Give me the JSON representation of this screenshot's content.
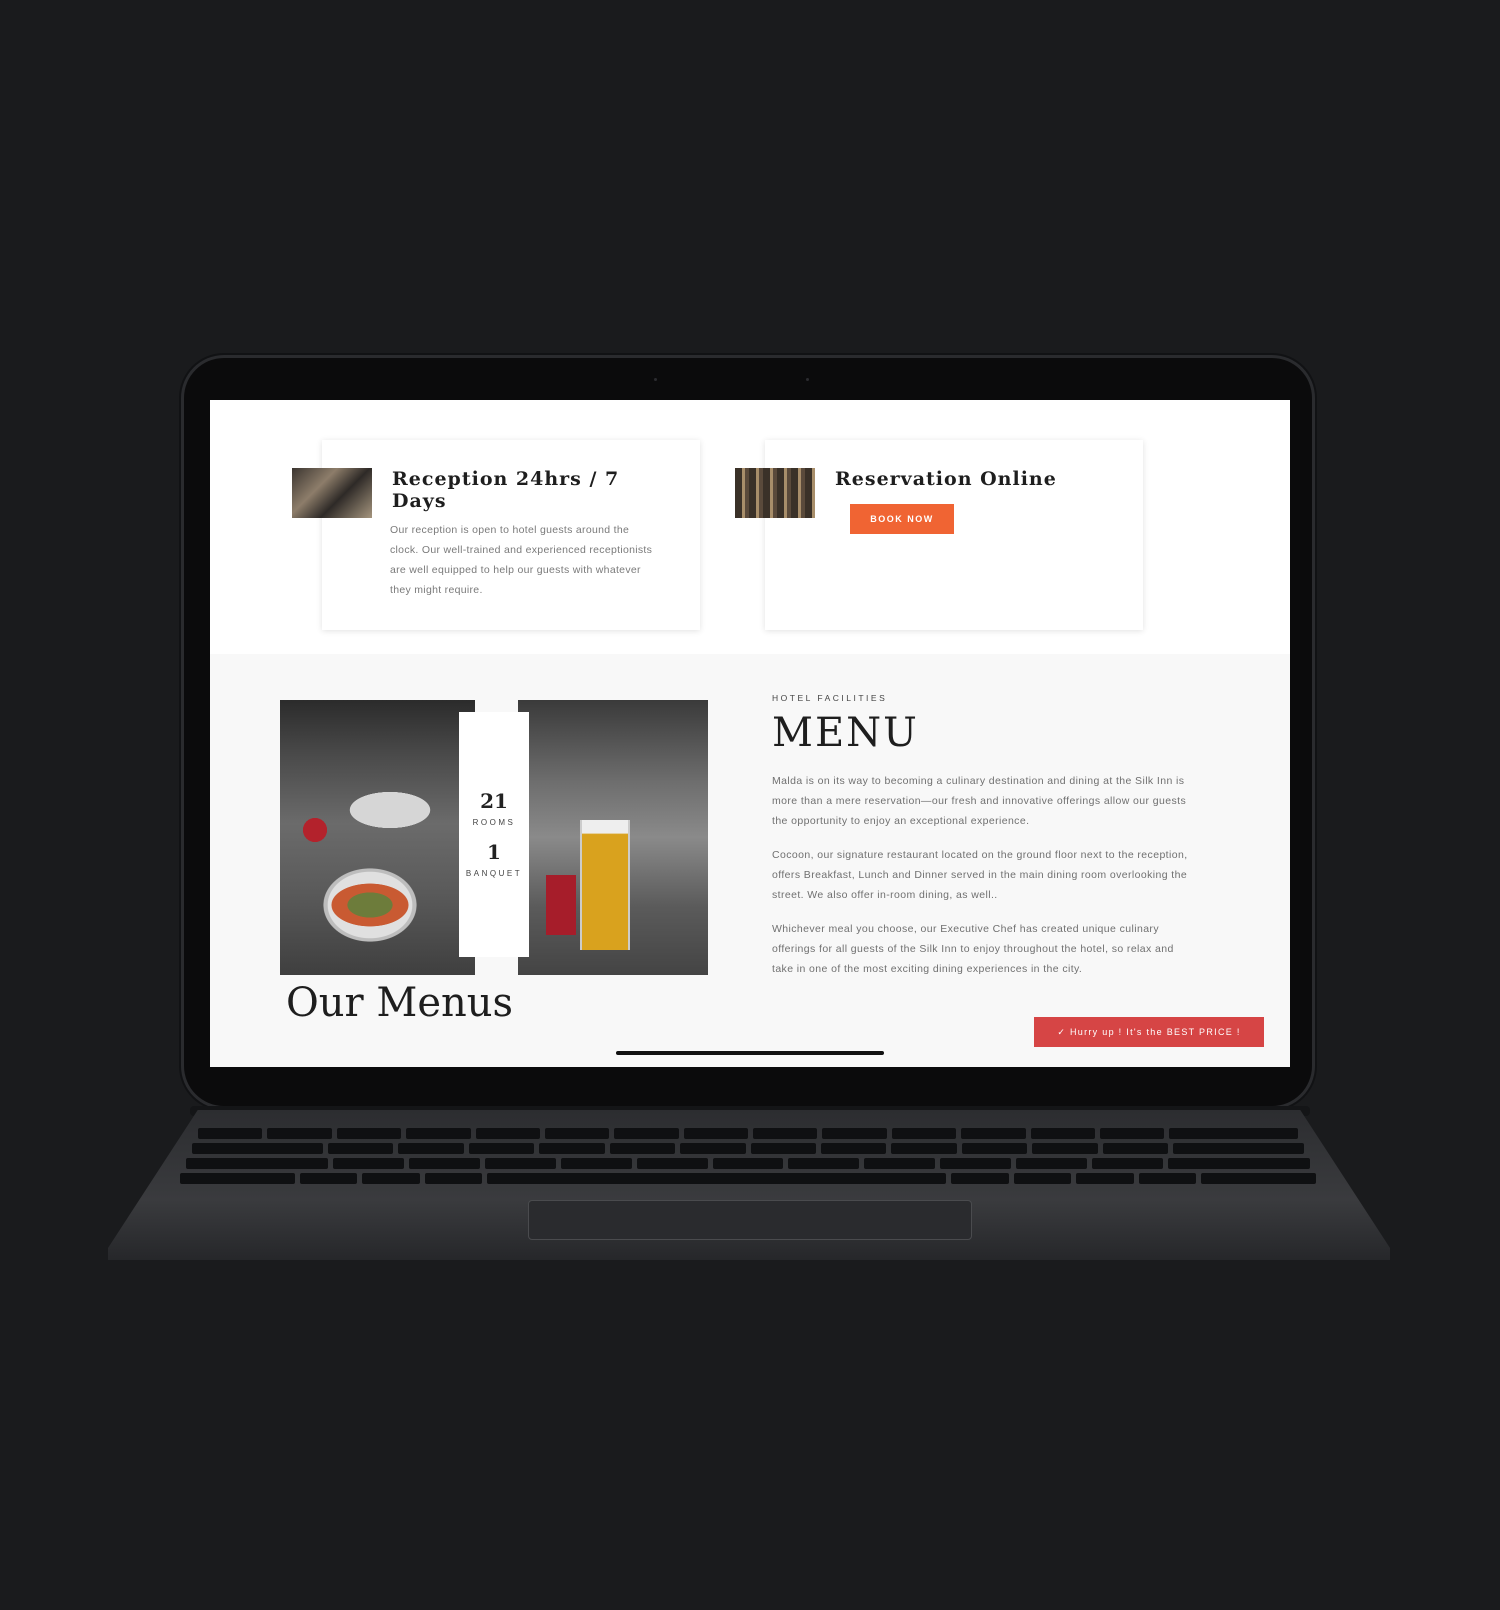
{
  "cards": {
    "reception": {
      "title": "Reception 24hrs / 7 Days",
      "text": "Our reception is open to hotel guests around the clock. Our well-trained and experienced receptionists are well equipped to help our guests with whatever they might require."
    },
    "reservation": {
      "title": "Reservation Online",
      "button_label": "BOOK NOW"
    }
  },
  "stats": [
    {
      "value": "21",
      "label": "ROOMS"
    },
    {
      "value": "1",
      "label": "BANQUET"
    }
  ],
  "facilities": {
    "eyebrow": "HOTEL FACILITIES",
    "heading": "MENU",
    "paragraphs": [
      "Malda is on its way to becoming a culinary destination and dining at the Silk Inn is more than a mere reservation—our fresh and innovative offerings allow our guests the opportunity to enjoy an exceptional experience.",
      "Cocoon, our signature restaurant located on the ground floor next to the reception, offers Breakfast, Lunch and Dinner served in the main dining room overlooking the street. We also offer in-room dining, as well..",
      "Whichever meal you choose, our Executive Chef has created unique culinary offerings for all guests of the Silk Inn to enjoy throughout the hotel, so relax and take in one of the most exciting dining experiences in the city."
    ]
  },
  "our_menus": {
    "heading": "Our Menus",
    "promo_label": "✓  Hurry up ! It's the BEST PRICE !"
  },
  "colors": {
    "book_button": "#f06433",
    "promo_button": "#d64545",
    "background": "#1a1b1d"
  },
  "icons": [
    "check-icon"
  ]
}
